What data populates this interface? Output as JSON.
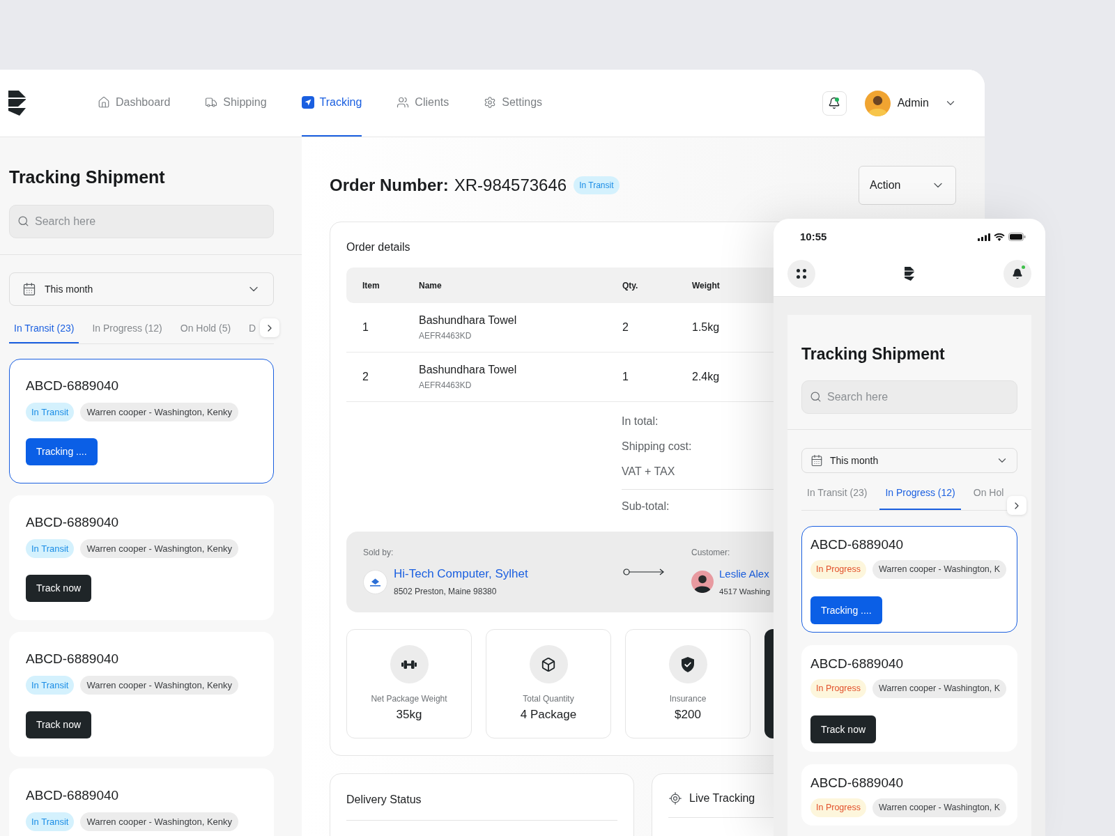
{
  "nav": {
    "items": [
      {
        "label": "Dashboard",
        "selected": false
      },
      {
        "label": "Shipping",
        "selected": false
      },
      {
        "label": "Tracking",
        "selected": true
      },
      {
        "label": "Clients",
        "selected": false
      },
      {
        "label": "Settings",
        "selected": false
      }
    ],
    "notifications": {
      "unread": true
    },
    "user": {
      "name": "Admin"
    }
  },
  "shipment_list": {
    "title": "Tracking Shipment",
    "search": {
      "placeholder": "Search here"
    },
    "period": {
      "value": "This month"
    },
    "tabs": [
      {
        "label": "In Transit (23)",
        "selected": true
      },
      {
        "label": "In Progress (12)",
        "selected": false
      },
      {
        "label": "On Hold (5)",
        "selected": false
      },
      {
        "label": "D",
        "selected": false
      }
    ],
    "shipments": [
      {
        "code": "ABCD-6889040",
        "selected": true,
        "status": {
          "label": "In Transit",
          "kind": "transit"
        },
        "route": "Warren cooper - Washington, Kenky",
        "button": "Tracking ...."
      },
      {
        "code": "ABCD-6889040",
        "selected": false,
        "status": {
          "label": "In Transit",
          "kind": "transit"
        },
        "route": "Warren cooper - Washington, Kenky",
        "button": "Track now"
      },
      {
        "code": "ABCD-6889040",
        "selected": false,
        "status": {
          "label": "In Transit",
          "kind": "transit"
        },
        "route": "Warren cooper - Washington, Kenky",
        "button": "Track now"
      },
      {
        "code": "ABCD-6889040",
        "selected": false,
        "status": {
          "label": "In Transit",
          "kind": "transit"
        },
        "route": "Warren cooper - Washington, Kenky"
      }
    ]
  },
  "order": {
    "label": "Order Number:",
    "number": "XR-984573646",
    "status": {
      "label": "In Transit",
      "kind": "transit"
    },
    "action": "Action",
    "details": {
      "title": "Order details",
      "columns": [
        "Item",
        "Name",
        "Qty.",
        "Weight"
      ],
      "rows": [
        {
          "item": "1",
          "name": "Bashundhara Towel",
          "sku": "AEFR4463KD",
          "qty": "2",
          "weight": "1.5kg"
        },
        {
          "item": "2",
          "name": "Bashundhara Towel",
          "sku": "AEFR4463KD",
          "qty": "1",
          "weight": "2.4kg"
        }
      ],
      "summary": [
        "In total:",
        "Shipping cost:",
        "VAT + TAX"
      ],
      "subtotal": "Sub-total:",
      "seller": {
        "label": "Sold by:",
        "name": "Hi-Tech Computer, Sylhet",
        "address": "8502 Preston, Maine 98380"
      },
      "customer": {
        "label": "Customer:",
        "name": "Leslie Alex",
        "address": "4517 Washing"
      },
      "stats": [
        {
          "label": "Net Package Weight",
          "value": "35kg"
        },
        {
          "label": "Total Quantity",
          "value": "4 Package"
        },
        {
          "label": "Insurance",
          "value": "$200"
        }
      ]
    }
  },
  "delivery_status": {
    "title": "Delivery Status"
  },
  "live_tracking": {
    "title": "Live Tracking"
  },
  "phone": {
    "time": "10:55",
    "notifications": {
      "unread": true
    },
    "shipment_list": {
      "title": "Tracking Shipment",
      "search": {
        "placeholder": "Search here"
      },
      "period": {
        "value": "This month"
      },
      "tabs": [
        {
          "label": "In Transit (23)",
          "selected": false
        },
        {
          "label": "In Progress (12)",
          "selected": true
        },
        {
          "label": "On Hol",
          "selected": false
        }
      ],
      "shipments": [
        {
          "code": "ABCD-6889040",
          "selected": true,
          "status": {
            "label": "In Progress",
            "kind": "progress"
          },
          "route": "Warren cooper - Washington, K",
          "button": "Tracking ...."
        },
        {
          "code": "ABCD-6889040",
          "selected": false,
          "status": {
            "label": "In Progress",
            "kind": "progress"
          },
          "route": "Warren cooper - Washington, K",
          "button": "Track now"
        },
        {
          "code": "ABCD-6889040",
          "selected": false,
          "status": {
            "label": "In Progress",
            "kind": "progress"
          },
          "route": "Warren cooper - Washington, K"
        }
      ]
    }
  }
}
